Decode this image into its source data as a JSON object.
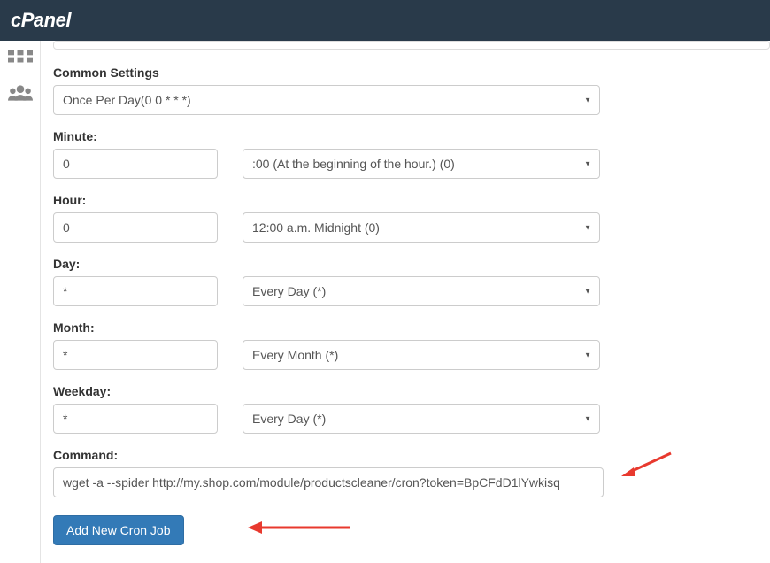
{
  "header": {
    "logo_text": "cPanel"
  },
  "form": {
    "common_settings_label": "Common Settings",
    "common_settings_value": "Once Per Day(0 0 * * *)",
    "minute_label": "Minute:",
    "minute_value": "0",
    "minute_select": ":00 (At the beginning of the hour.) (0)",
    "hour_label": "Hour:",
    "hour_value": "0",
    "hour_select": "12:00 a.m. Midnight (0)",
    "day_label": "Day:",
    "day_value": "*",
    "day_select": "Every Day (*)",
    "month_label": "Month:",
    "month_value": "*",
    "month_select": "Every Month (*)",
    "weekday_label": "Weekday:",
    "weekday_value": "*",
    "weekday_select": "Every Day (*)",
    "command_label": "Command:",
    "command_value": "wget -a --spider http://my.shop.com/module/productscleaner/cron?token=BpCFdD1lYwkisq",
    "submit_label": "Add New Cron Job"
  }
}
